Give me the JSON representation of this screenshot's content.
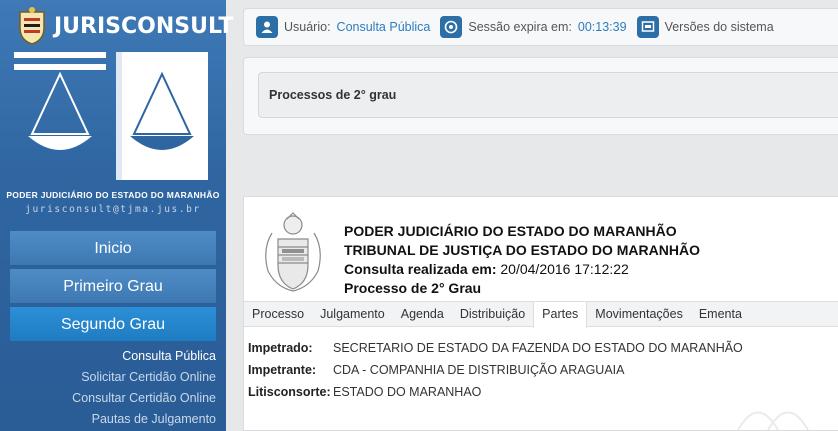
{
  "brand": {
    "logo_text": "JURISCONSULT",
    "court_name": "PODER JUDICIÁRIO DO ESTADO DO MARANHÃO",
    "email": "jurisconsult@tjma.jus.br"
  },
  "nav": {
    "items": [
      {
        "label": "Inicio",
        "active": false
      },
      {
        "label": "Primeiro Grau",
        "active": false
      },
      {
        "label": "Segundo Grau",
        "active": true
      }
    ],
    "sub_items": [
      {
        "label": "Consulta Pública",
        "active": true
      },
      {
        "label": "Solicitar Certidão Online",
        "active": false
      },
      {
        "label": "Consultar Certidão Online",
        "active": false
      },
      {
        "label": "Pautas de Julgamento",
        "active": false
      }
    ]
  },
  "topbar": {
    "user_label": "Usuário:",
    "user_value": "Consulta Pública",
    "session_label": "Sessão expira em:",
    "session_value": "00:13:39",
    "versions_label": "Versões do sistema"
  },
  "process_panel": {
    "title": "Processos de 2° grau"
  },
  "report": {
    "line1": "PODER JUDICIÁRIO DO ESTADO DO MARANHÃO",
    "line2": "TRIBUNAL DE JUSTIÇA DO ESTADO DO MARANHÃO",
    "line3_label": "Consulta realizada em:",
    "line3_value": "20/04/2016 17:12:22",
    "line4": "Processo de 2° Grau",
    "tabs": [
      {
        "label": "Processo",
        "active": false
      },
      {
        "label": "Julgamento",
        "active": false
      },
      {
        "label": "Agenda",
        "active": false
      },
      {
        "label": "Distribuição",
        "active": false
      },
      {
        "label": "Partes",
        "active": true
      },
      {
        "label": "Movimentações",
        "active": false
      },
      {
        "label": "Ementa",
        "active": false
      }
    ],
    "parties": [
      {
        "label": "Impetrado:",
        "value": "SECRETARIO DE ESTADO DA FAZENDA DO ESTADO DO MARANHÃO"
      },
      {
        "label": "Impetrante:",
        "value": "CDA - COMPANHIA DE DISTRIBUIÇÃO ARAGUAIA"
      },
      {
        "label": "Litisconsorte:",
        "value": "ESTADO DO MARANHAO"
      }
    ]
  },
  "colors": {
    "sidebar": "#2f66a2",
    "nav_active": "#1f7cc2",
    "link": "#2d7cc0"
  }
}
